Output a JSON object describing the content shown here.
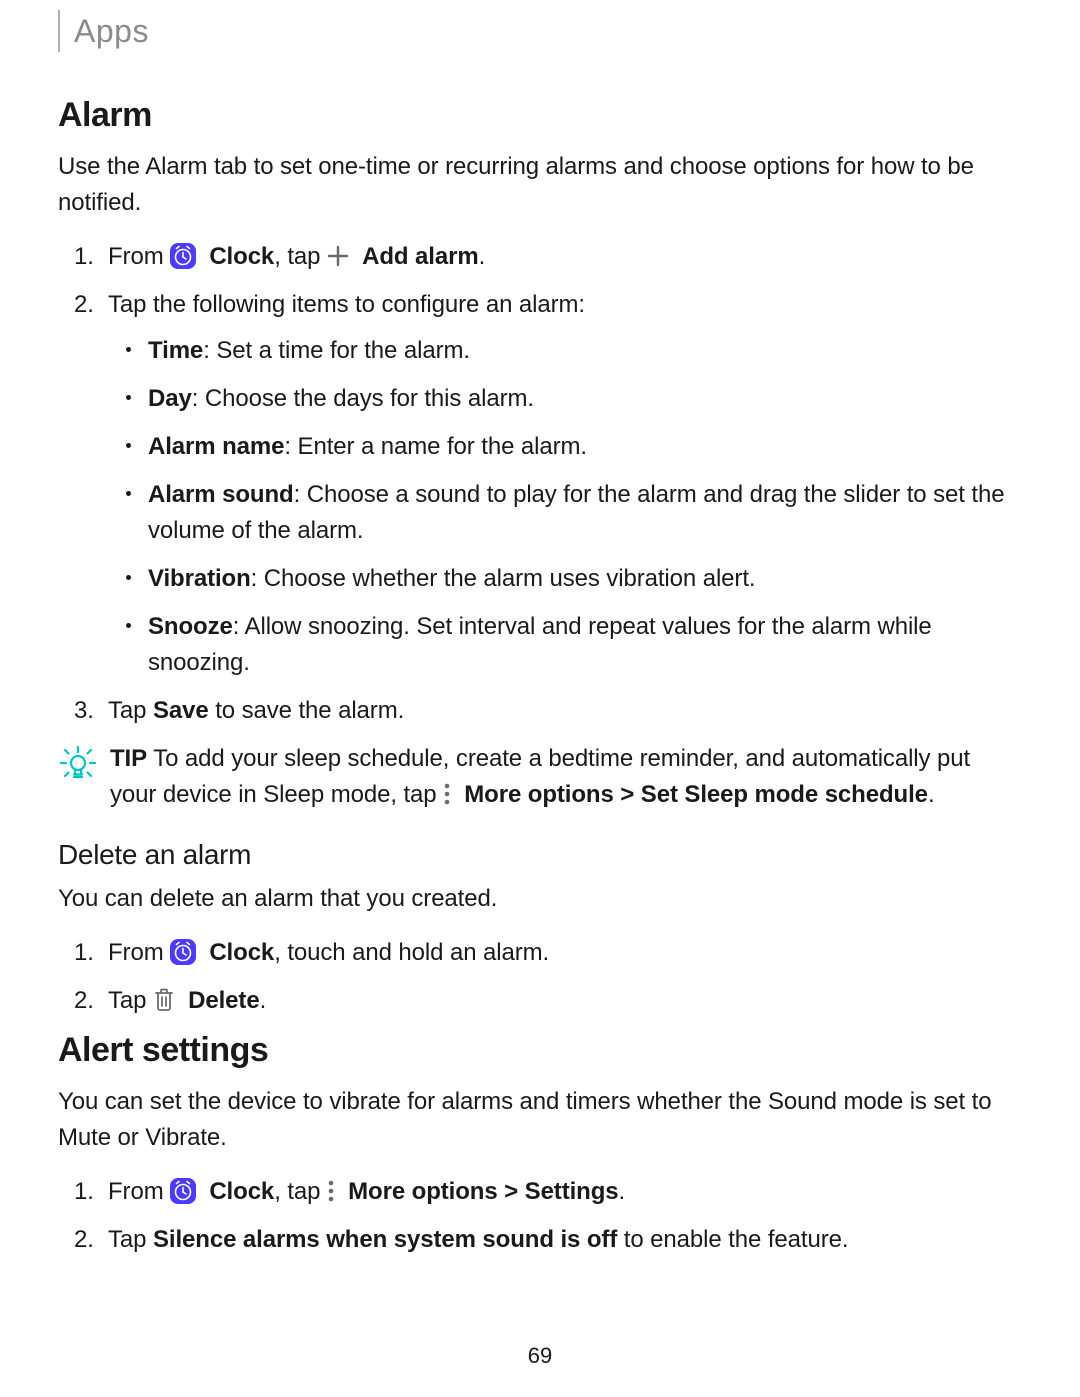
{
  "breadcrumb": "Apps",
  "page_number": "69",
  "alarm": {
    "title": "Alarm",
    "intro": "Use the Alarm tab to set one-time or recurring alarms and choose options for how to be notified.",
    "step1_prefix": "From ",
    "clock_label": "Clock",
    "step1_mid": ", tap ",
    "add_alarm_label": "Add alarm",
    "step1_end": ".",
    "step2": "Tap the following items to configure an alarm:",
    "items": {
      "time_b": "Time",
      "time_r": ": Set a time for the alarm.",
      "day_b": "Day",
      "day_r": ": Choose the days for this alarm.",
      "name_b": "Alarm name",
      "name_r": ": Enter a name for the alarm.",
      "sound_b": "Alarm sound",
      "sound_r": ": Choose a sound to play for the alarm and drag the slider to set the volume of the alarm.",
      "vib_b": "Vibration",
      "vib_r": ": Choose whether the alarm uses vibration alert.",
      "snooze_b": "Snooze",
      "snooze_r": ": Allow snoozing. Set interval and repeat values for the alarm while snoozing."
    },
    "step3_pre": "Tap ",
    "step3_b": "Save",
    "step3_post": " to save the alarm.",
    "tip_label": "TIP",
    "tip_text_pre": "  To add your sleep schedule, create a bedtime reminder, and automatically put your device in Sleep mode, tap ",
    "tip_more_options": "More options",
    "tip_sep": " > ",
    "tip_schedule": "Set Sleep mode schedule",
    "tip_end": "."
  },
  "delete": {
    "title": "Delete an alarm",
    "intro": "You can delete an alarm that you created.",
    "step1_prefix": "From ",
    "clock_label": "Clock",
    "step1_post": ", touch and hold an alarm.",
    "step2_pre": "Tap ",
    "delete_label": "Delete",
    "step2_end": "."
  },
  "alert": {
    "title": "Alert settings",
    "intro": "You can set the device to vibrate for alarms and timers whether the Sound mode is set to Mute or Vibrate.",
    "step1_prefix": "From ",
    "clock_label": "Clock",
    "step1_mid": ", tap ",
    "more_options": "More options",
    "sep": " > ",
    "settings": "Settings",
    "step1_end": ".",
    "step2_pre": "Tap ",
    "step2_b": "Silence alarms when system sound is off",
    "step2_post": " to enable the feature."
  }
}
